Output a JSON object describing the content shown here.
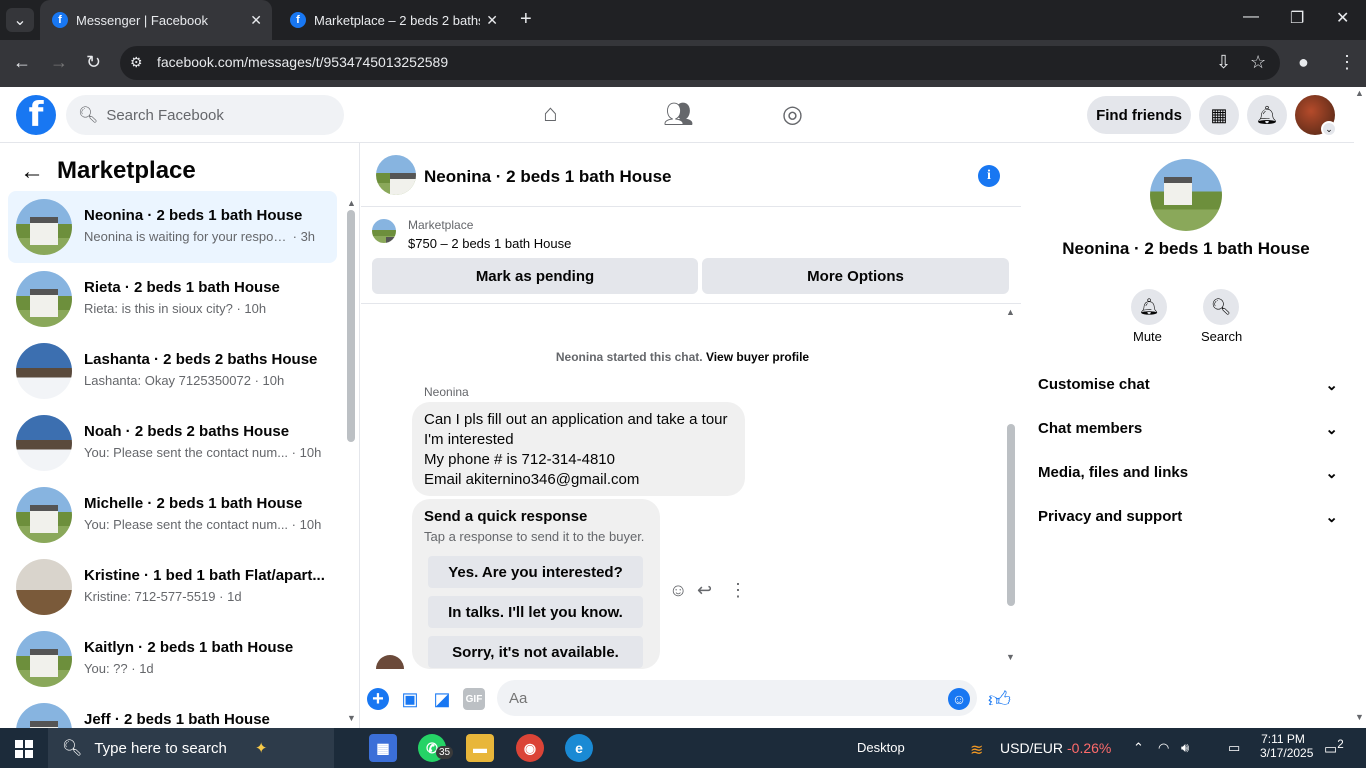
{
  "browser": {
    "tabs": [
      {
        "title": "Messenger | Facebook",
        "active": true
      },
      {
        "title": "Marketplace – 2 beds 2 baths H",
        "active": false
      }
    ],
    "url": "facebook.com/messages/t/9534745013252589"
  },
  "fb": {
    "search_placeholder": "Search Facebook",
    "find_friends": "Find friends"
  },
  "left": {
    "title": "Marketplace",
    "conversations": [
      {
        "name": "Neonina · 2 beds 1 bath House",
        "preview": "Neonina is waiting for your respon...",
        "time": "· 3h"
      },
      {
        "name": "Rieta · 2 beds 1 bath House",
        "preview": "Rieta: is this in sioux city?",
        "time": "· 10h"
      },
      {
        "name": "Lashanta · 2 beds 2 baths House",
        "preview": "Lashanta: Okay 7125350072",
        "time": "· 10h"
      },
      {
        "name": "Noah · 2 beds 2 baths House",
        "preview": "You: Please sent the contact num...",
        "time": "· 10h"
      },
      {
        "name": "Michelle · 2 beds 1 bath House",
        "preview": "You: Please sent the contact num...",
        "time": "· 10h"
      },
      {
        "name": "Kristine · 1 bed 1 bath Flat/apart...",
        "preview": "Kristine: 712-577-5519",
        "time": "· 1d"
      },
      {
        "name": "Kaitlyn · 2 beds 1 bath House",
        "preview": "You: ??",
        "time": "· 1d"
      },
      {
        "name": "Jeff · 2 beds 1 bath House",
        "preview": "",
        "time": ""
      }
    ]
  },
  "chat": {
    "title": "Neonina · 2 beds 1 bath House",
    "marketplace_label": "Marketplace",
    "listing": "$750 – 2 beds 1 bath House",
    "mark_pending": "Mark as pending",
    "more_options": "More Options",
    "started_text": "Neonina started this chat.",
    "view_profile": "View buyer profile",
    "sender": "Neonina",
    "message_lines": [
      "Can I pls fill out an application and take a tour",
      "I'm interested",
      "My phone # is 712-314-4810",
      "Email akiternino346@gmail.com"
    ],
    "quick_title": "Send a quick response",
    "quick_sub": "Tap a response to send it to the buyer.",
    "quick_replies": [
      "Yes. Are you interested?",
      "In talks. I'll let you know.",
      "Sorry, it's not available."
    ],
    "input_placeholder": "Aa"
  },
  "right": {
    "name": "Neonina · 2 beds 1 bath House",
    "mute": "Mute",
    "search": "Search",
    "sections": [
      "Customise chat",
      "Chat members",
      "Media, files and links",
      "Privacy and support"
    ]
  },
  "taskbar": {
    "search": "Type here to search",
    "whatsapp_badge": "35",
    "desktop": "Desktop",
    "currency": "USD/EUR",
    "change": "-0.26%",
    "time": "7:11 PM",
    "date": "3/17/2025",
    "notif": "2"
  },
  "colors": {
    "fb_blue": "#1877f2",
    "negative": "#ff6b6b"
  }
}
